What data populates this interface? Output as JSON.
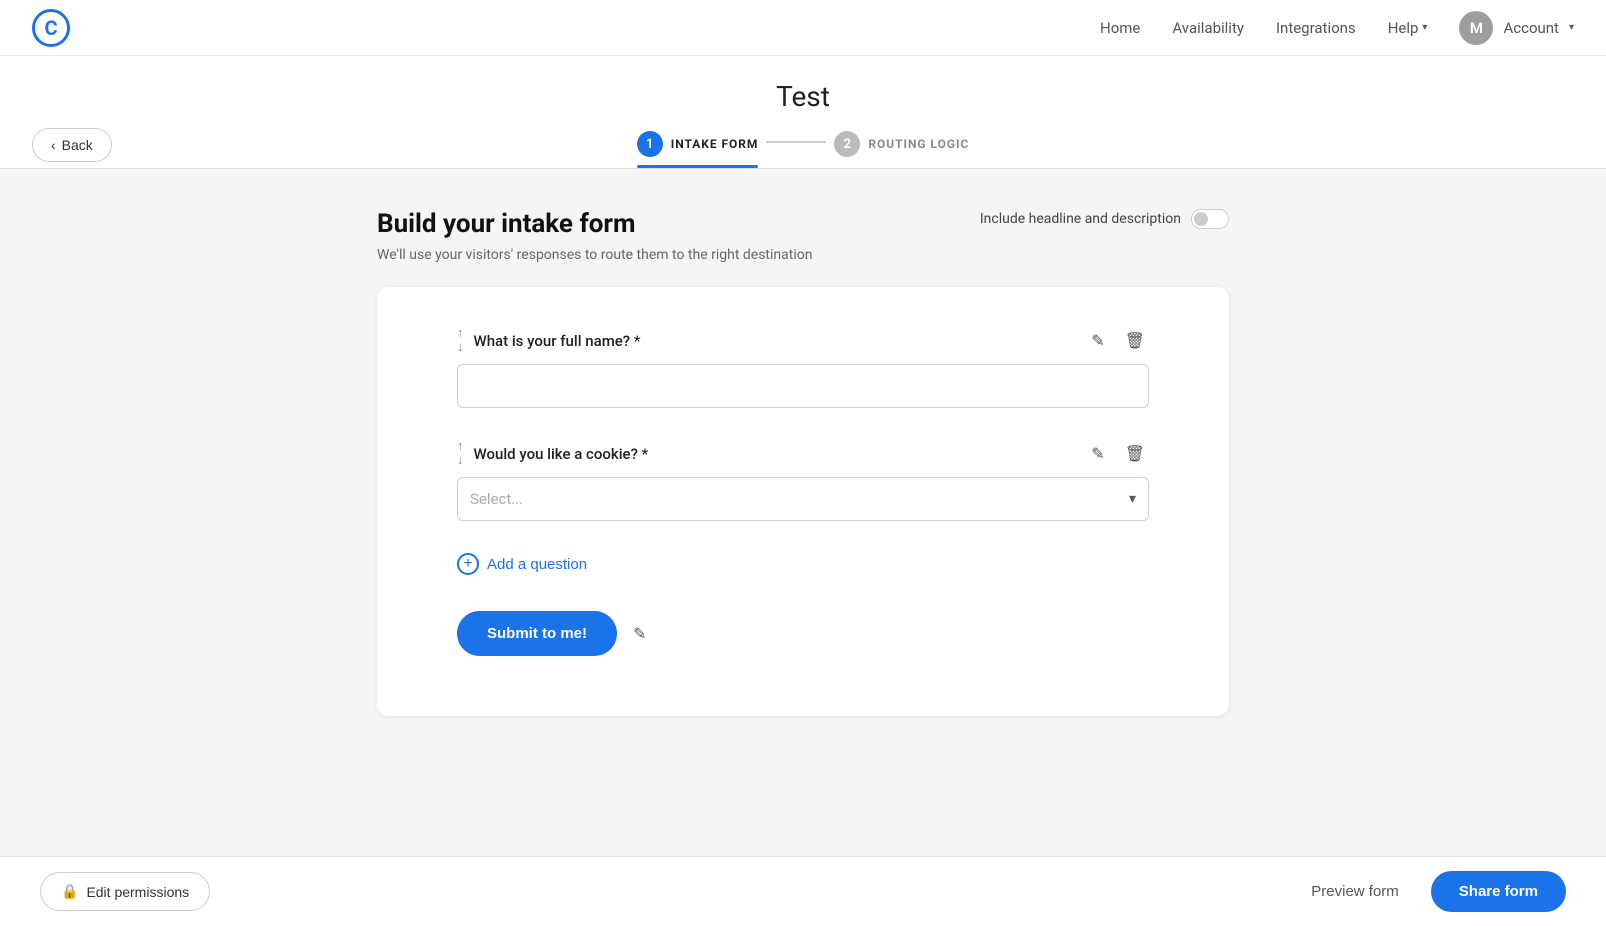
{
  "app": {
    "logo_letter": "C"
  },
  "nav": {
    "home": "Home",
    "availability": "Availability",
    "integrations": "Integrations",
    "help": "Help",
    "account": "Account",
    "avatar_letter": "M"
  },
  "header": {
    "back_label": "Back",
    "page_title": "Test",
    "step1_number": "1",
    "step1_label": "INTAKE FORM",
    "step2_number": "2",
    "step2_label": "ROUTING LOGIC"
  },
  "main": {
    "section_title": "Build your intake form",
    "section_sub": "We'll use your visitors' responses to route them to the right destination",
    "include_headline_label": "Include headline and description",
    "questions": [
      {
        "id": "q1",
        "label": "What is your full name?",
        "required": true,
        "type": "text",
        "placeholder": ""
      },
      {
        "id": "q2",
        "label": "Would you like a cookie?",
        "required": true,
        "type": "select",
        "placeholder": "Select..."
      }
    ],
    "add_question_label": "Add a question",
    "submit_button_label": "Submit to me!"
  },
  "bottom_bar": {
    "edit_permissions_label": "Edit permissions",
    "preview_label": "Preview form",
    "share_label": "Share form"
  }
}
